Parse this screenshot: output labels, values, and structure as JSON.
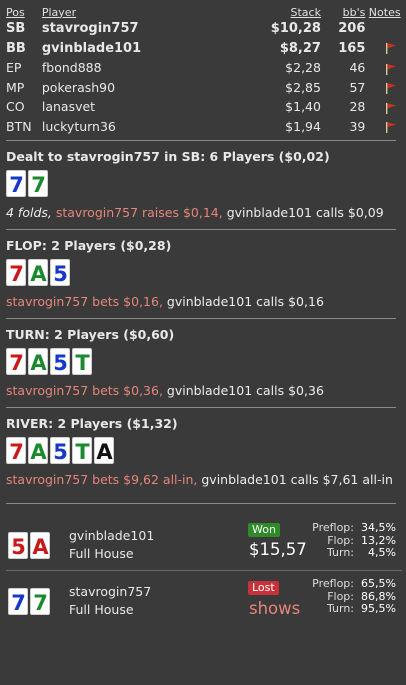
{
  "table": {
    "headers": {
      "pos": "Pos",
      "player": "Player",
      "stack": "Stack",
      "bbs": "bb's",
      "notes": "Notes"
    },
    "rows": [
      {
        "pos": "SB",
        "player": "stavrogin757",
        "stack": "$10,28",
        "bbs": "206",
        "flag": false,
        "hero": true
      },
      {
        "pos": "BB",
        "player": "gvinblade101",
        "stack": "$8,27",
        "bbs": "165",
        "flag": true,
        "hero": true
      },
      {
        "pos": "EP",
        "player": "fbond888",
        "stack": "$2,28",
        "bbs": "46",
        "flag": true,
        "hero": false
      },
      {
        "pos": "MP",
        "player": "pokerash90",
        "stack": "$2,85",
        "bbs": "57",
        "flag": true,
        "hero": false
      },
      {
        "pos": "CO",
        "player": "lanasvet",
        "stack": "$1,40",
        "bbs": "28",
        "flag": true,
        "hero": false
      },
      {
        "pos": "BTN",
        "player": "luckyturn36",
        "stack": "$1,94",
        "bbs": "39",
        "flag": true,
        "hero": false
      }
    ]
  },
  "preflop": {
    "title": "Dealt to stavrogin757 in SB: 6 Players ($0,02)",
    "cards": [
      {
        "rank": "7",
        "suit": "d"
      },
      {
        "rank": "7",
        "suit": "c"
      }
    ],
    "actions": [
      {
        "text": "4 folds, ",
        "style": "folds"
      },
      {
        "text": "stavrogin757 raises $0,14, ",
        "style": "hero"
      },
      {
        "text": "gvinblade101 calls $0,09",
        "style": "norm"
      }
    ]
  },
  "flop": {
    "title": "FLOP: 2 Players ($0,28)",
    "cards": [
      {
        "rank": "7",
        "suit": "h"
      },
      {
        "rank": "A",
        "suit": "c"
      },
      {
        "rank": "5",
        "suit": "d"
      }
    ],
    "actions": [
      {
        "text": "stavrogin757 bets $0,16, ",
        "style": "hero"
      },
      {
        "text": "gvinblade101 calls $0,16",
        "style": "norm"
      }
    ]
  },
  "turn": {
    "title": "TURN: 2 Players ($0,60)",
    "cards": [
      {
        "rank": "7",
        "suit": "h"
      },
      {
        "rank": "A",
        "suit": "c"
      },
      {
        "rank": "5",
        "suit": "d"
      },
      {
        "rank": "T",
        "suit": "c"
      }
    ],
    "actions": [
      {
        "text": "stavrogin757 bets $0,36, ",
        "style": "hero"
      },
      {
        "text": "gvinblade101 calls $0,36",
        "style": "norm"
      }
    ]
  },
  "river": {
    "title": "RIVER: 2 Players ($1,32)",
    "cards": [
      {
        "rank": "7",
        "suit": "h"
      },
      {
        "rank": "A",
        "suit": "c"
      },
      {
        "rank": "5",
        "suit": "d"
      },
      {
        "rank": "T",
        "suit": "c"
      },
      {
        "rank": "A",
        "suit": "s"
      }
    ],
    "actions": [
      {
        "text": "stavrogin757 bets $9,62 all-in, ",
        "style": "hero"
      },
      {
        "text": "gvinblade101 calls $7,61 all-in",
        "style": "norm"
      }
    ]
  },
  "results": [
    {
      "cards": [
        {
          "rank": "5",
          "suit": "h"
        },
        {
          "rank": "A",
          "suit": "h"
        }
      ],
      "player": "gvinblade101",
      "hand": "Full House",
      "badge": "Won",
      "outcome": "won",
      "amount": "$15,57",
      "equity": [
        {
          "label": "Preflop:",
          "value": "34,5%"
        },
        {
          "label": "Flop:",
          "value": "13,2%"
        },
        {
          "label": "Turn:",
          "value": "4,5%"
        }
      ]
    },
    {
      "cards": [
        {
          "rank": "7",
          "suit": "d"
        },
        {
          "rank": "7",
          "suit": "c"
        }
      ],
      "player": "stavrogin757",
      "hand": "Full House",
      "badge": "Lost",
      "outcome": "lost",
      "amount": "shows",
      "equity": [
        {
          "label": "Preflop:",
          "value": "65,5%"
        },
        {
          "label": "Flop:",
          "value": "86,8%"
        },
        {
          "label": "Turn:",
          "value": "95,5%"
        }
      ]
    }
  ],
  "colors": {
    "background": "#3a3a3a",
    "hero_action": "#e6857a",
    "won_badge": "#2f8a2a",
    "lost_badge": "#c7323a",
    "flag": "#c8321e",
    "club": "#1b8a2e",
    "diamond": "#1438c8",
    "heart": "#c81a1a",
    "spade": "#111111"
  },
  "icons": {
    "notes_flag": "flag-icon"
  }
}
